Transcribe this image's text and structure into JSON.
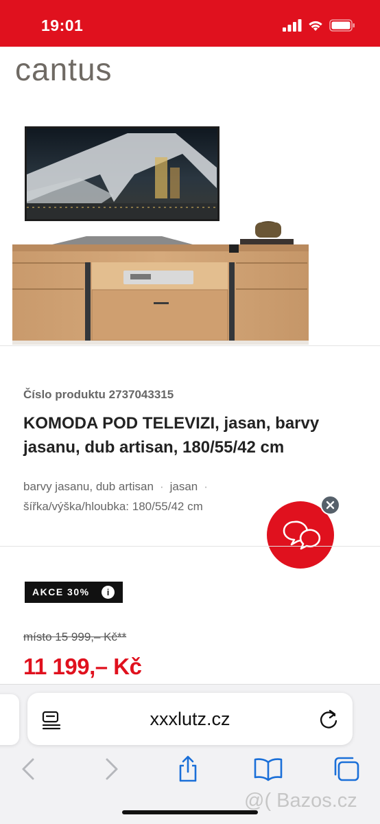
{
  "status_bar": {
    "time": "19:01"
  },
  "brand": {
    "logo_text": "cantus"
  },
  "product": {
    "number_label": "Číslo produktu 2737043315",
    "title_bold": "KOMODA",
    "title_rest": " POD TELEVIZI, jasan, barvy jasanu, dub artisan, 180/55/42 cm",
    "attributes": [
      "barvy jasanu, dub artisan",
      "jasan"
    ],
    "attribute_separator": "·",
    "dimensions": "šířka/výška/hloubka: 180/55/42 cm"
  },
  "promo": {
    "badge": "AKCE 30%",
    "info_icon": "i"
  },
  "pricing": {
    "old_price": "místo 15 999,– Kč**",
    "price": "11 199,– Kč"
  },
  "browser": {
    "url": "xxxlutz.cz"
  },
  "watermark": "@( Bazos.cz",
  "colors": {
    "brand_red": "#e0111e",
    "badge_black": "#111111",
    "logo_gray": "#6f6a64"
  },
  "icons": [
    "signal-icon",
    "wifi-icon",
    "battery-icon",
    "chat-icon",
    "close-icon",
    "info-icon",
    "reader-icon",
    "reload-icon",
    "back-icon",
    "forward-icon",
    "share-icon",
    "bookmarks-icon",
    "tabs-icon"
  ]
}
